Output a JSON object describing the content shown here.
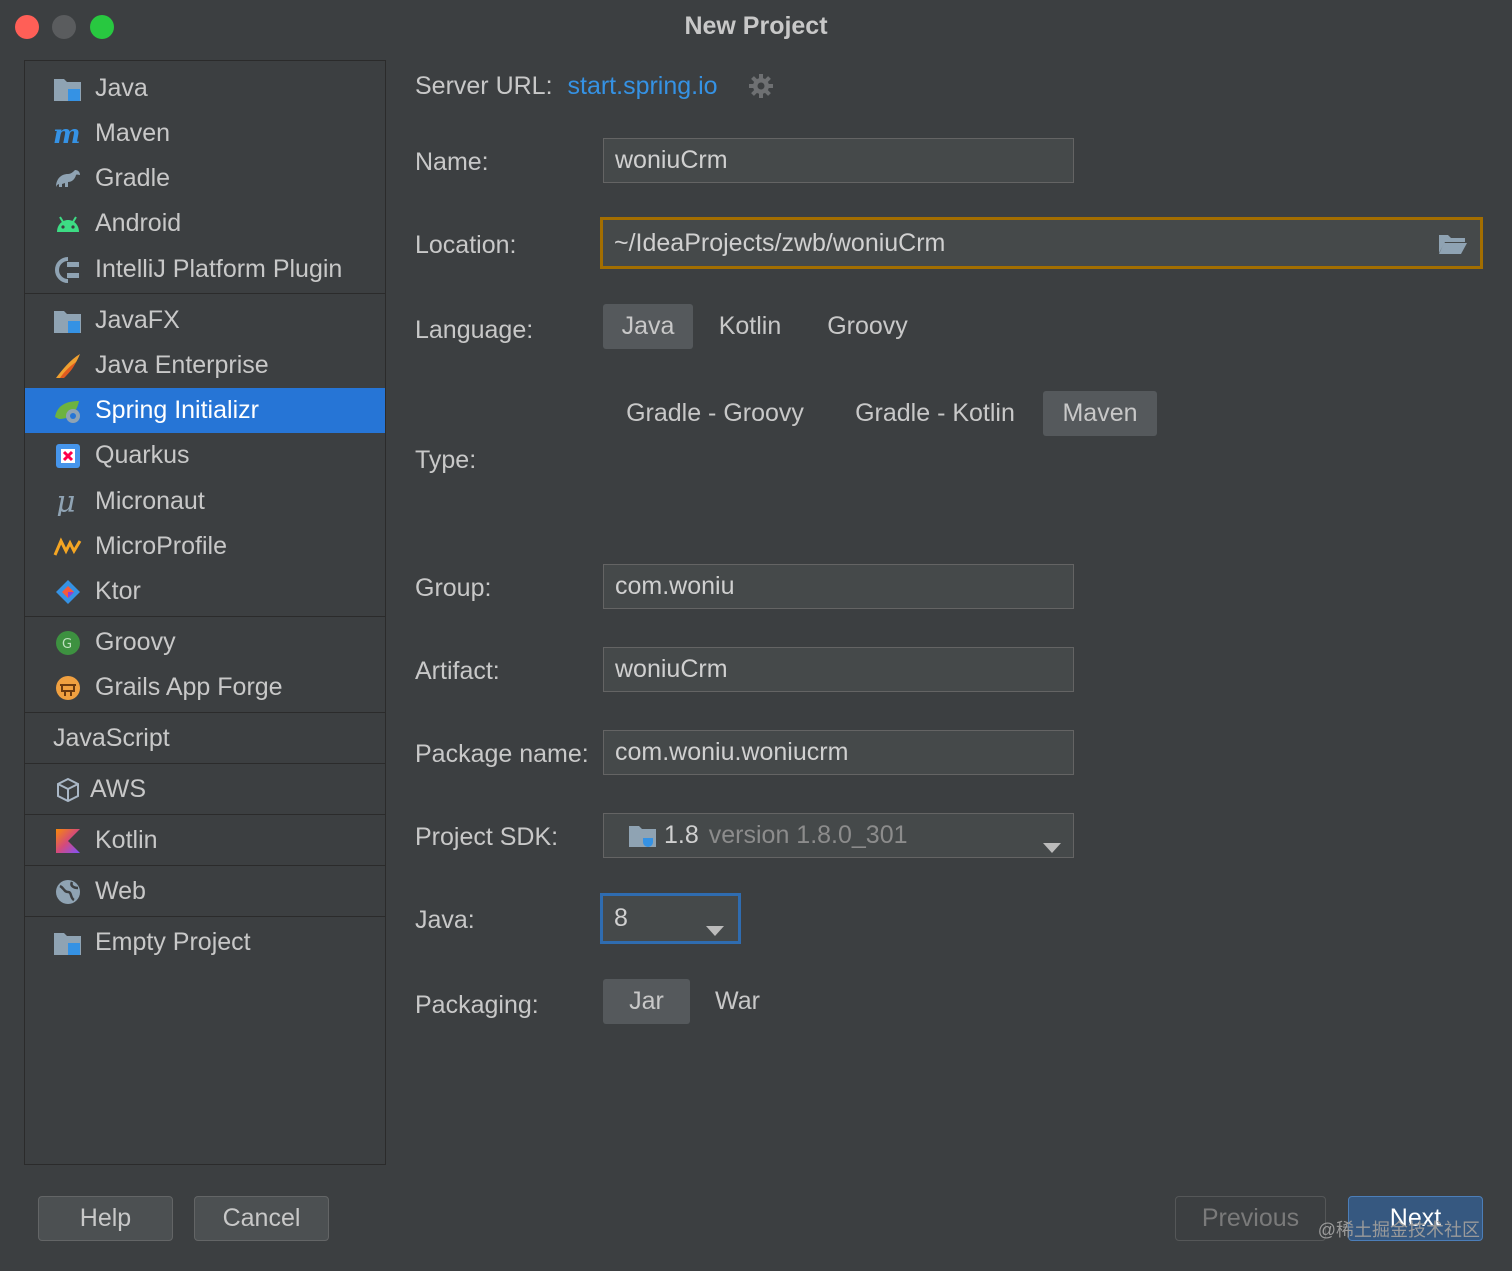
{
  "window": {
    "title": "New Project"
  },
  "sidebar": {
    "items": [
      {
        "label": "Java",
        "icon": "java-folder-icon"
      },
      {
        "label": "Maven",
        "icon": "maven-icon"
      },
      {
        "label": "Gradle",
        "icon": "gradle-icon"
      },
      {
        "label": "Android",
        "icon": "android-icon"
      },
      {
        "label": "IntelliJ Platform Plugin",
        "icon": "plugin-icon"
      },
      {
        "label": "JavaFX",
        "icon": "javafx-folder-icon"
      },
      {
        "label": "Java Enterprise",
        "icon": "java-enterprise-icon"
      },
      {
        "label": "Spring Initializr",
        "icon": "spring-icon",
        "selected": true
      },
      {
        "label": "Quarkus",
        "icon": "quarkus-icon"
      },
      {
        "label": "Micronaut",
        "icon": "micronaut-icon"
      },
      {
        "label": "MicroProfile",
        "icon": "microprofile-icon"
      },
      {
        "label": "Ktor",
        "icon": "ktor-icon"
      },
      {
        "label": "Groovy",
        "icon": "groovy-icon"
      },
      {
        "label": "Grails App Forge",
        "icon": "grails-icon"
      },
      {
        "label": "JavaScript",
        "icon": ""
      },
      {
        "label": "AWS",
        "icon": "aws-cube-icon"
      },
      {
        "label": "Kotlin",
        "icon": "kotlin-icon"
      },
      {
        "label": "Web",
        "icon": "web-globe-icon"
      },
      {
        "label": "Empty Project",
        "icon": "empty-project-folder-icon"
      }
    ]
  },
  "form": {
    "server_url_label": "Server URL:",
    "server_url": "start.spring.io",
    "name_label": "Name:",
    "name": "woniuCrm",
    "location_label": "Location:",
    "location": "~/IdeaProjects/zwb/woniuCrm",
    "language_label": "Language:",
    "languages": [
      "Java",
      "Kotlin",
      "Groovy"
    ],
    "language_selected": "Java",
    "type_label": "Type:",
    "types": [
      "Gradle - Groovy",
      "Gradle - Kotlin",
      "Maven"
    ],
    "type_selected": "Maven",
    "group_label": "Group:",
    "group": "com.woniu",
    "artifact_label": "Artifact:",
    "artifact": "woniuCrm",
    "package_label": "Package name:",
    "package": "com.woniu.woniucrm",
    "sdk_label": "Project SDK:",
    "sdk_name": "1.8",
    "sdk_version": "version 1.8.0_301",
    "java_label": "Java:",
    "java": "8",
    "packaging_label": "Packaging:",
    "packagings": [
      "Jar",
      "War"
    ],
    "packaging_selected": "Jar"
  },
  "buttons": {
    "help": "Help",
    "cancel": "Cancel",
    "previous": "Previous",
    "next": "Next"
  },
  "watermark": "@稀土掘金技术社区",
  "colors": {
    "accent": "#2675d6",
    "link": "#3592e4",
    "focus_border": "#a36e00"
  }
}
